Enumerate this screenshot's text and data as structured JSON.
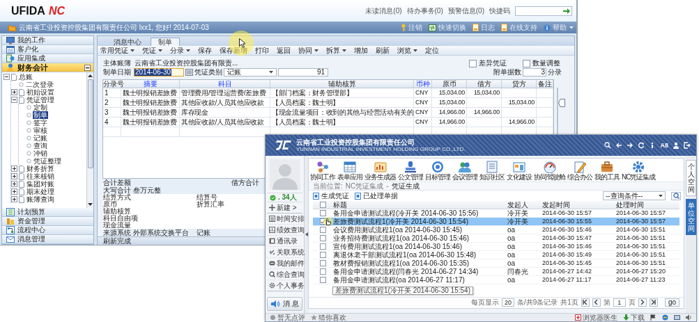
{
  "main_window": {
    "logo": {
      "text": "UFIDA",
      "mark": "NC"
    },
    "header_links": [
      "未读消息(0)",
      "待办事务(0)",
      "预警信息(0)"
    ],
    "quick_code": {
      "label": "快捷码"
    },
    "greeting": "云南省工业投资控股集团有限责任公司 lxx1, 您好! 2014-07-03",
    "top_actions": [
      "注销",
      "快速切换",
      "日志",
      "在线支持",
      "帮助"
    ],
    "nav_top": [
      {
        "label": "我的工作",
        "selected": false
      },
      {
        "label": "客户化",
        "selected": false
      },
      {
        "label": "应用集成",
        "selected": false
      },
      {
        "label": "财务会计",
        "selected": true
      }
    ],
    "tree": [
      {
        "label": "总账",
        "expanded": true,
        "selected": false,
        "children": [
          {
            "label": "二次登录",
            "selected": false
          },
          {
            "label": "初始设置",
            "expanded": false,
            "selected": false
          },
          {
            "label": "凭证管理",
            "expanded": true,
            "selected": false,
            "children": [
              {
                "label": "定制",
                "selected": false
              },
              {
                "label": "制单",
                "selected": true
              },
              {
                "label": "签字",
                "selected": false
              },
              {
                "label": "审核",
                "selected": false
              },
              {
                "label": "记账",
                "selected": false
              },
              {
                "label": "查询",
                "selected": false
              },
              {
                "label": "冲销",
                "selected": false
              },
              {
                "label": "凭证整理",
                "selected": false
              }
            ]
          },
          {
            "label": "财务折算",
            "expanded": false,
            "selected": false
          },
          {
            "label": "往来核销",
            "expanded": false,
            "selected": false
          },
          {
            "label": "集团对账",
            "expanded": false,
            "selected": false
          },
          {
            "label": "期末处理",
            "expanded": false,
            "selected": false
          },
          {
            "label": "账簿查询",
            "expanded": false,
            "selected": false
          }
        ]
      }
    ],
    "nav_bottom": [
      {
        "label": "计划预算",
        "selected": false
      },
      {
        "label": "资金管理",
        "selected": false
      },
      {
        "label": "流程中心",
        "selected": false
      },
      {
        "label": "消息管理",
        "selected": false
      }
    ],
    "tabs": [
      {
        "label": "消息中心",
        "selected": false
      },
      {
        "label": "制单",
        "selected": true
      }
    ],
    "toolbar": [
      {
        "label": "常用凭证",
        "dropdown": true
      },
      {
        "label": "凭证",
        "dropdown": true
      },
      {
        "label": "分录",
        "dropdown": true
      },
      {
        "label": "保存",
        "dropdown": false
      },
      {
        "label": "保存新增",
        "dropdown": false
      },
      {
        "label": "打印",
        "dropdown": false
      },
      {
        "label": "返回",
        "dropdown": false
      },
      {
        "label": "协同",
        "dropdown": true
      },
      {
        "label": "拆算",
        "dropdown": true
      },
      {
        "label": "增加",
        "dropdown": false
      },
      {
        "label": "刷新",
        "dropdown": false
      },
      {
        "label": "浏览",
        "dropdown": true
      },
      {
        "label": "定位",
        "dropdown": false
      }
    ],
    "ledger": {
      "label": "主体账簿",
      "value": "云南省工业投资控股集团有限责..."
    },
    "date": {
      "label": "制单日期",
      "value": "2014-06-30",
      "highlighted": true
    },
    "voucher_type": {
      "label": "凭证类别",
      "value": "记账",
      "number": "91"
    },
    "options": [
      {
        "label": "差异凭证",
        "checked": false
      },
      {
        "label": "数量调整",
        "checked": false
      }
    ],
    "attachments": {
      "label": "附单据数",
      "value": "3",
      "suffix": "分录"
    },
    "table": {
      "columns": [
        {
          "label": "分录号",
          "required": false
        },
        {
          "label": "摘要",
          "required": true
        },
        {
          "label": "科目",
          "required": true
        },
        {
          "label": "辅助核算",
          "required": false
        },
        {
          "label": "币种",
          "required": true
        },
        {
          "label": "原币",
          "required": false
        },
        {
          "label": "借方",
          "required": false
        },
        {
          "label": "贷方",
          "required": false
        },
        {
          "label": "备注",
          "required": false
        }
      ],
      "rows": [
        [
          "1",
          "魏士明报销差旅费",
          "管理费用/管理运营费/差旅费",
          "【部门档案：财务管理部】",
          "CNY",
          "15,034.00",
          "15,034.00",
          null,
          null
        ],
        [
          "2",
          "魏士明报销差旅费",
          "其他应收款/人员其他应收款",
          "【人员档案：魏士明】",
          "CNY",
          "15,034.00",
          null,
          "15,034.00",
          null
        ],
        [
          "3",
          "魏士明报销差旅费",
          "库存现金",
          "【现金流量项目：收到的其他与经营活动有关的",
          "CNY",
          "14,966.00",
          "14,966.00",
          null,
          null
        ],
        [
          "4",
          "魏士明报销差旅费",
          "其他应收款/人员其他应收款",
          "【人员档案：魏士明】",
          "CNY",
          "14,966.00",
          null,
          "14,966.00",
          null
        ]
      ]
    },
    "difference": {
      "label": "合计差额",
      "debit_total": "借方合计"
    },
    "amount_in_words": "大写合计 叁万元整",
    "details": [
      [
        "结算方式",
        "结算号"
      ],
      [
        "原币",
        "折算汇率"
      ],
      [
        "辅助核算"
      ],
      [
        "科目自由项"
      ],
      [
        "现金流量"
      ]
    ],
    "source": [
      "来源系统 外部系统交换平台",
      "记账"
    ],
    "status": "刷新完成"
  },
  "messenger_window": {
    "company": "云南省工业投资控股集团有限责任公司",
    "company_en": "YUNNAN INDUSTRIAL INVESTMENT HOLDING GROUP CO.,LTD.",
    "product": "A8",
    "online": ". 34人",
    "menu": [
      "新建 >",
      "时间安排",
      "绩效查询",
      "通讯录",
      "关联系统",
      "我的邮件",
      "综合查询",
      "个人事务"
    ],
    "message_button": "消 息",
    "apps": [
      "协同工作",
      "表单应用",
      "业务生成器",
      "公文管理",
      "目标管理",
      "会议管理",
      "知识社区",
      "文化建设",
      "协同驾驶舱",
      "综合办公",
      "我的工具",
      "NC凭证集成"
    ],
    "breadcrumb": {
      "label": "当前位置:",
      "path": "NC凭证集成",
      "separator": "-",
      "current": "凭证生成"
    },
    "actions": [
      "生成凭证",
      "已处理单据"
    ],
    "query": "--查询条件--",
    "table": {
      "header_checked": false,
      "columns": [
        "标题",
        "发起人",
        "发起时间",
        "处理时间"
      ],
      "rows": [
        {
          "checked": false,
          "selected": false,
          "cells": [
            "备用金申请测试流程(冷开美 2014-06-30 15:56)",
            "冷开美",
            "2014-06-30 15:57",
            "2014-06-30 15:57"
          ]
        },
        {
          "checked": true,
          "selected": true,
          "cells": [
            "差旅费测试流程1(冷开美 2014-06-30 15:54)",
            "冷开美",
            "2014-06-30 15:55",
            "2014-06-30 15:57"
          ]
        },
        {
          "checked": false,
          "selected": false,
          "cells": [
            "会议费用测试流程1(oa 2014-06-30 15:45)",
            "oa",
            "2014-06-30 15:46",
            "2014-06-30 15:51"
          ]
        },
        {
          "checked": false,
          "selected": false,
          "cells": [
            "业务招待费测试流程1(oa 2014-06-30 15:46)",
            "oa",
            "2014-06-30 15:47",
            "2014-06-30 15:51"
          ]
        },
        {
          "checked": false,
          "selected": false,
          "cells": [
            "宣传费用测试流程1(oa 2014-06-30 15:46)",
            "oa",
            "2014-06-30 15:46",
            "2014-06-30 15:51"
          ]
        },
        {
          "checked": false,
          "selected": false,
          "cells": [
            "离退休老干部测试流程1(oa 2014-06-30 15:48)",
            "oa",
            "2014-06-30 15:49",
            "2014-06-30 15:51"
          ]
        },
        {
          "checked": false,
          "selected": false,
          "cells": [
            "教材费报销测试流程1(oa 2014-06-30 15:35)",
            "oa",
            "2014-06-30 15:45",
            "2014-06-30 15:51"
          ]
        },
        {
          "checked": false,
          "selected": false,
          "cells": [
            "备用金申请测试流程(闫春光 2014-06-27 14:34)",
            "闫春光",
            "2014-06-27 14:42",
            "2014-06-27 15:20"
          ]
        },
        {
          "checked": false,
          "selected": false,
          "cells": [
            "备用金申请测试流程(oa 2014-06-27 11:17)",
            "oa",
            "2014-06-27 11:17",
            "2014-06-27 11:23"
          ]
        }
      ]
    },
    "tooltip": "差旅费测试流程1(冷开美 2014-06-30 15:54)",
    "pager": {
      "per_page_label": "每页显示",
      "per_page": "20",
      "count": "条/共9条记录",
      "pages": "共1页",
      "page_label": "第",
      "page": "1",
      "page_suffix": "页",
      "go": "go"
    },
    "side_tabs": [
      {
        "label": "个人空间",
        "selected": false
      },
      {
        "label": "单位空间",
        "selected": true
      }
    ],
    "status_left": [
      "暂无点评",
      "猜你喜欢"
    ],
    "status_right": [
      "浏览器医生",
      "下载"
    ]
  }
}
